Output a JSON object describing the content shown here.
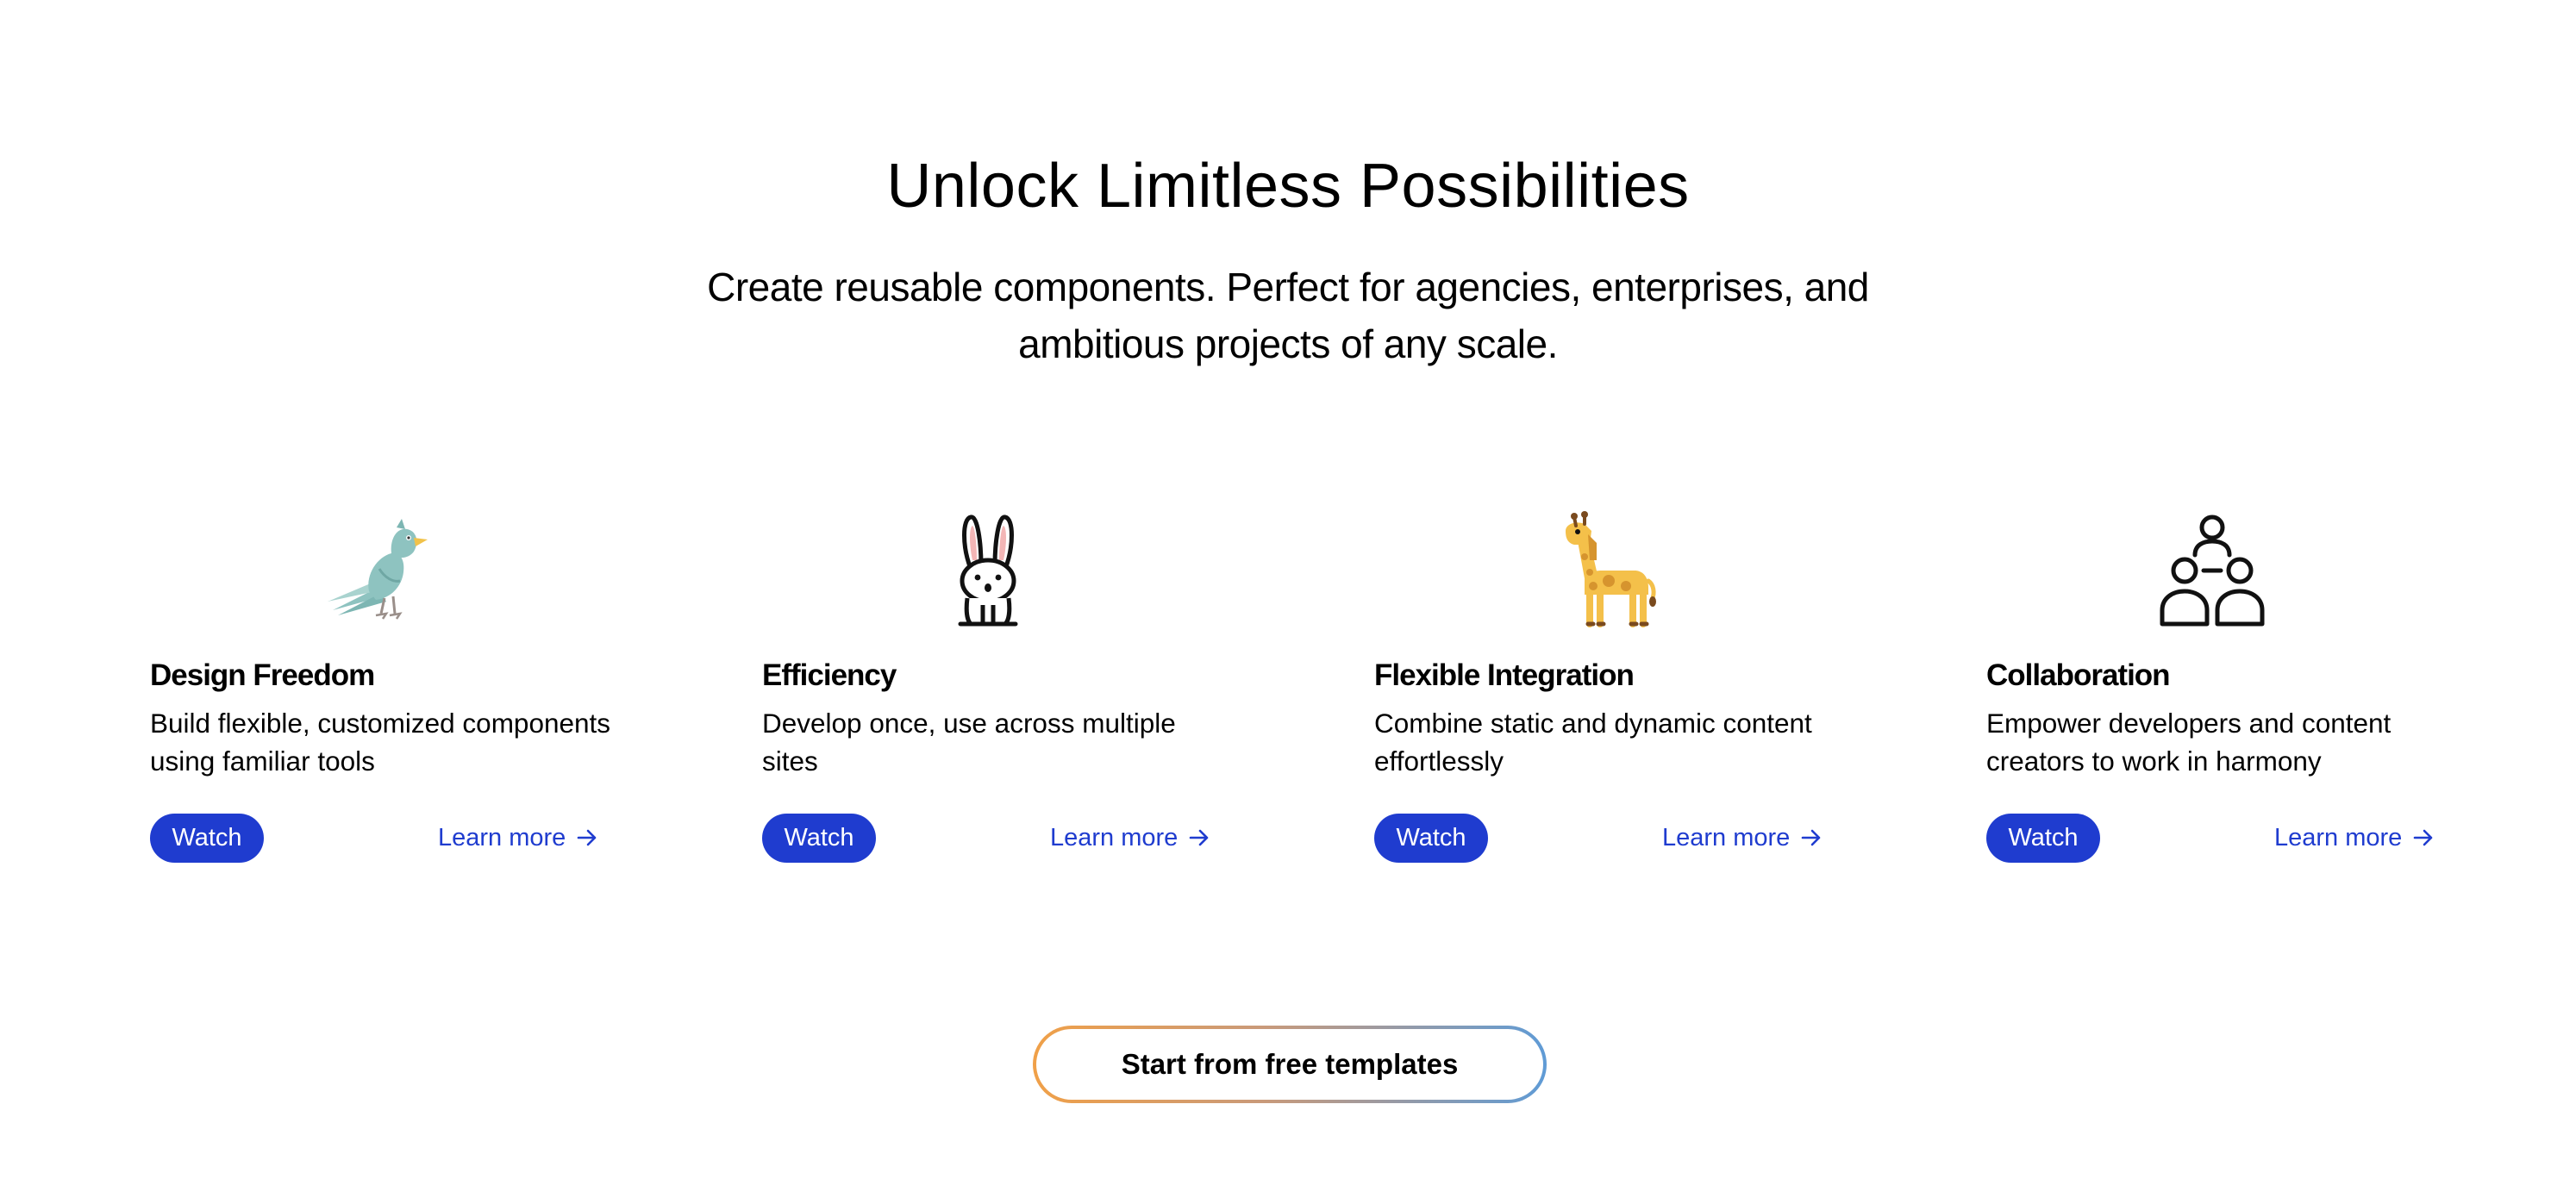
{
  "hero": {
    "title": "Unlock Limitless Possibilities",
    "subtitle": "Create reusable components. Perfect for agencies, enterprises, and ambitious projects of any scale."
  },
  "features": [
    {
      "icon": "bird-icon",
      "title": "Design Freedom",
      "description": "Build flexible, customized components using familiar tools",
      "watch_label": "Watch",
      "learn_label": "Learn more"
    },
    {
      "icon": "rabbit-icon",
      "title": "Efficiency",
      "description": "Develop once, use across multiple sites",
      "watch_label": "Watch",
      "learn_label": "Learn more"
    },
    {
      "icon": "giraffe-icon",
      "title": "Flexible Integration",
      "description": "Combine static and dynamic content effortlessly",
      "watch_label": "Watch",
      "learn_label": "Learn more"
    },
    {
      "icon": "people-group-icon",
      "title": "Collaboration",
      "description": "Empower developers and content creators to work in harmony",
      "watch_label": "Watch",
      "learn_label": "Learn more"
    }
  ],
  "cta": {
    "label": "Start from free templates"
  },
  "colors": {
    "accent": "#1f3ccf",
    "gradient_start": "#f0a048",
    "gradient_end": "#5f9bd6"
  }
}
